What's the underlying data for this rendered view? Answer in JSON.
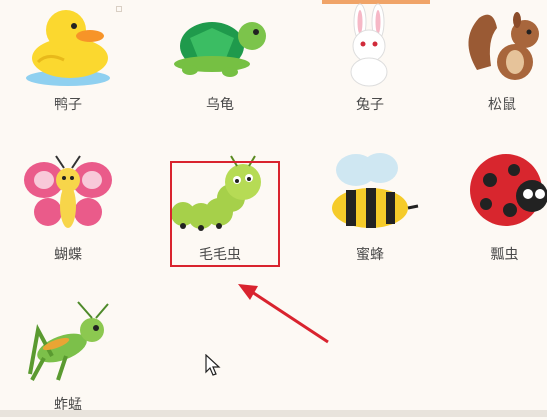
{
  "animals": [
    {
      "id": "duck",
      "label": "鸭子",
      "icon": "duck-icon"
    },
    {
      "id": "turtle",
      "label": "乌龟",
      "icon": "turtle-icon"
    },
    {
      "id": "rabbit",
      "label": "兔子",
      "icon": "rabbit-icon"
    },
    {
      "id": "squirrel",
      "label": "松鼠",
      "icon": "squirrel-icon"
    },
    {
      "id": "butterfly",
      "label": "蝴蝶",
      "icon": "butterfly-icon"
    },
    {
      "id": "caterpillar",
      "label": "毛毛虫",
      "icon": "caterpillar-icon"
    },
    {
      "id": "bee",
      "label": "蜜蜂",
      "icon": "bee-icon"
    },
    {
      "id": "ladybug",
      "label": "瓢虫",
      "icon": "ladybug-icon"
    },
    {
      "id": "grasshopper",
      "label": "蚱蜢",
      "icon": "grasshopper-icon"
    }
  ],
  "colors": {
    "accent": "#f0a468",
    "highlight": "#d9232e",
    "background": "#fdf9f4",
    "text": "#4a4a4a"
  }
}
